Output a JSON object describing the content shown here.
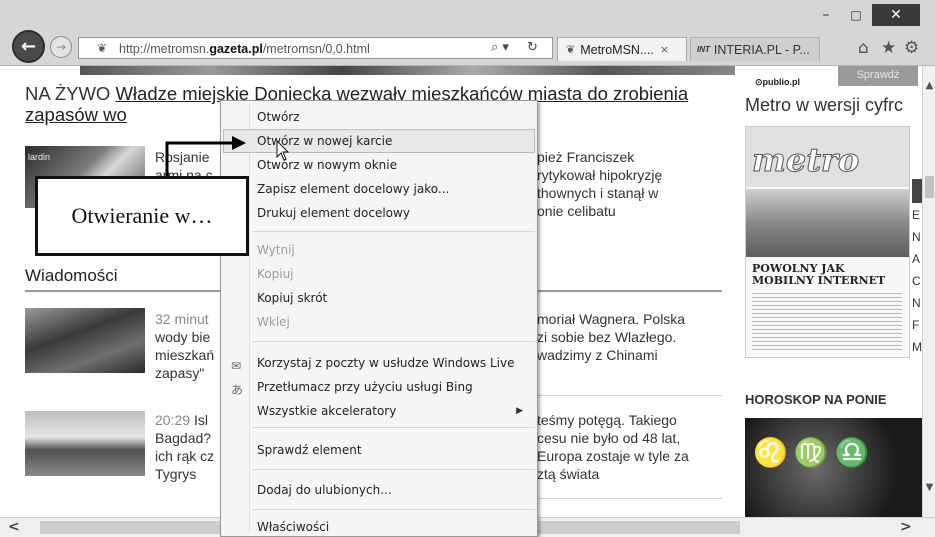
{
  "window": {
    "minimize": "–",
    "maximize": "□",
    "close": "✕"
  },
  "nav": {
    "back": "←",
    "forward": "→"
  },
  "address": {
    "prefix": "http://metromsn.",
    "domain": "gazeta.pl",
    "suffix": "/metromsn/0,0.html",
    "search_icon": "⌕ ▾",
    "refresh_icon": "↻"
  },
  "tabs": [
    {
      "label": "MetroMSN....",
      "close": "×",
      "active": true
    },
    {
      "label": "INTERIA.PL - P...",
      "badge": "INT",
      "active": false
    }
  ],
  "toolbar": {
    "home": "⌂",
    "favorites": "★",
    "settings": "⚙"
  },
  "page": {
    "headline_live": "NA ŻYWO",
    "headline_link": "Władze miejskie Doniecka wezwały mieszkańców miasta do zrobienia zapasów wo",
    "thumb1_label": "lardin",
    "story1": {
      "left": [
        "Rosjanie",
        "armi na c"
      ],
      "right": [
        "pież Franciszek",
        "rytykował hipokryzję",
        "thownych i stanął w",
        "onie celibatu"
      ]
    },
    "section_title": "Wiadomości",
    "story2": {
      "time": "32 minut",
      "left": [
        "wody bie",
        "mieszkań",
        "zapasy\""
      ],
      "right": [
        "moriał Wagnera. Polska",
        "zi sobie bez Wlazłego.",
        "wadzimy z Chinami"
      ]
    },
    "story3": {
      "time": "20:29",
      "left_first": "Isl",
      "left": [
        "Bagdad?",
        "ich rąk cz",
        "Tygrys"
      ],
      "right": [
        "teśmy potęgą. Takiego",
        "cesu nie było od 48 lat,",
        "Europa zostaje w tyle za",
        "ztą świata"
      ]
    },
    "right_col": {
      "publio": "⊙publio.pl",
      "sprawdz": "Sprawdź",
      "metro_title": "Metro w wersji cyfrc",
      "cover_logo": "metro",
      "cover_headline": [
        "POWOLNY JAK",
        "MOBILNY INTERNET"
      ],
      "side_letters": [
        "E",
        "N",
        "A",
        "C",
        "N",
        "F",
        "M"
      ],
      "horoscope": "HOROSKOP NA PONIE",
      "horo_glyphs": "♌♍♎"
    }
  },
  "context_menu": {
    "items": [
      {
        "label": "Otwórz",
        "disabled": false
      },
      {
        "label": "Otwórz w nowej karcie",
        "disabled": false,
        "highlight": true
      },
      {
        "label": "Otwórz w nowym oknie",
        "disabled": false
      },
      {
        "label": "Zapisz element docelowy jako...",
        "disabled": false
      },
      {
        "label": "Drukuj element docelowy",
        "disabled": false
      },
      {
        "label": "Wytnij",
        "disabled": true
      },
      {
        "label": "Kopiuj",
        "disabled": true
      },
      {
        "label": "Kopiuj skrót",
        "disabled": false
      },
      {
        "label": "Wklej",
        "disabled": true
      },
      {
        "label": "Korzystaj z poczty w usłudze Windows Live",
        "disabled": false,
        "icon": "✉"
      },
      {
        "label": "Przetłumacz przy użyciu usługi Bing",
        "disabled": false,
        "icon": "あ"
      },
      {
        "label": "Wszystkie akceleratory",
        "disabled": false,
        "submenu": "▶"
      },
      {
        "label": "Sprawdź element",
        "disabled": false
      },
      {
        "label": "Dodaj do ulubionych...",
        "disabled": false
      },
      {
        "label": "Właściwości",
        "disabled": false
      }
    ]
  },
  "callout": {
    "text": "Otwieranie w…"
  },
  "scroll": {
    "up": "▲",
    "down": "▼",
    "left": "<",
    "right": ">"
  }
}
